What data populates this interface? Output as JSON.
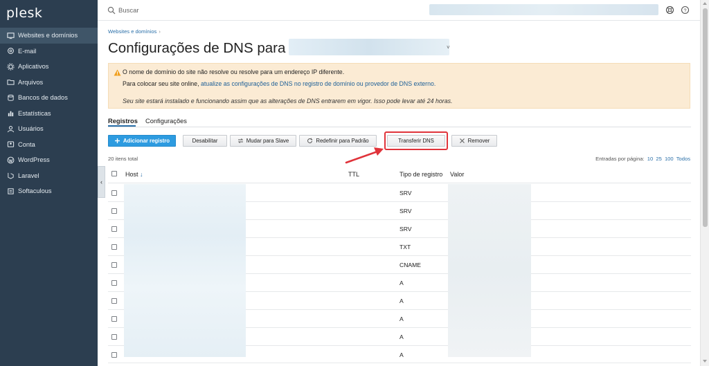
{
  "app": {
    "logo": "plesk"
  },
  "sidebar": {
    "items": [
      {
        "label": "Websites e domínios",
        "icon": "monitor-icon",
        "active": true
      },
      {
        "label": "E-mail",
        "icon": "mail-icon"
      },
      {
        "label": "Aplicativos",
        "icon": "apps-gear-icon"
      },
      {
        "label": "Arquivos",
        "icon": "folder-icon"
      },
      {
        "label": "Bancos de dados",
        "icon": "database-icon"
      },
      {
        "label": "Estatísticas",
        "icon": "bar-chart-icon"
      },
      {
        "label": "Usuários",
        "icon": "user-icon"
      },
      {
        "label": "Conta",
        "icon": "account-icon"
      },
      {
        "label": "WordPress",
        "icon": "wordpress-icon"
      },
      {
        "label": "Laravel",
        "icon": "laravel-icon"
      },
      {
        "label": "Softaculous",
        "icon": "softaculous-icon"
      }
    ],
    "collapse_glyph": "‹"
  },
  "topbar": {
    "search_placeholder": "Buscar",
    "icons": [
      "search-icon",
      "lifebuoy-icon",
      "help-icon"
    ]
  },
  "breadcrumb": {
    "item": "Websites e domínios",
    "separator": "›"
  },
  "page": {
    "title": "Configurações de DNS para",
    "title_caret": "˅"
  },
  "alert": {
    "line1": "O nome de domínio do site não resolve ou resolve para um endereço IP diferente.",
    "line2_prefix": "Para colocar seu site online, ",
    "line2_link": "atualize as configurações de DNS no registro de domínio ou provedor de DNS externo.",
    "line3": "Seu site estará instalado e funcionando assim que as alterações de DNS entrarem em vigor. Isso pode levar até 24 horas.",
    "color": "#fbebd4"
  },
  "tabs": [
    {
      "label": "Registros",
      "active": true
    },
    {
      "label": "Configurações",
      "active": false
    }
  ],
  "toolbar": {
    "add": "Adicionar registro",
    "disable": "Desabilitar",
    "slave": "Mudar para Slave",
    "reset": "Redefinir para Padrão",
    "transfer": "Transferir DNS",
    "remove": "Remover"
  },
  "list": {
    "total": "20 itens total",
    "per_page_label": "Entradas por página:",
    "per_page_options": [
      "10",
      "25",
      "100",
      "Todos"
    ]
  },
  "table": {
    "columns": {
      "host": "Host",
      "sort_indicator": "↓",
      "ttl": "TTL",
      "type": "Tipo de registro",
      "value": "Valor"
    },
    "rows": [
      {
        "type": "SRV"
      },
      {
        "type": "SRV"
      },
      {
        "type": "SRV"
      },
      {
        "type": "TXT"
      },
      {
        "type": "CNAME"
      },
      {
        "type": "A"
      },
      {
        "type": "A"
      },
      {
        "type": "A"
      },
      {
        "type": "A"
      },
      {
        "type": "A"
      }
    ]
  },
  "colors": {
    "sidebar": "#2c3e50",
    "accent": "#2d9be0",
    "link": "#2a6fa8",
    "highlight": "#e0333a"
  }
}
